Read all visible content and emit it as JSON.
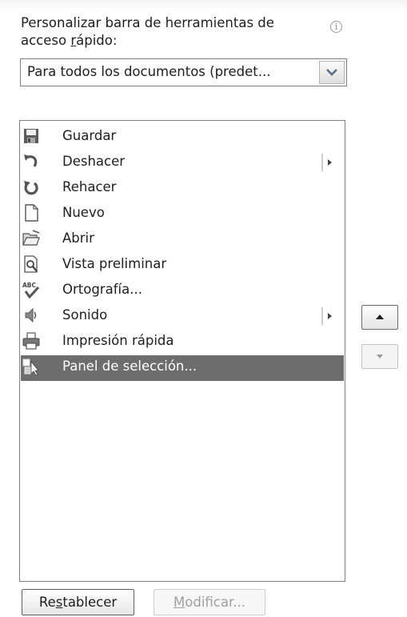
{
  "toolbar_panel": {
    "heading_line1": "Personalizar barra de herramientas de",
    "heading_line2_pre": "acceso ",
    "heading_line2_accel": "r",
    "heading_line2_post": "ápido:",
    "info_icon": "i",
    "scope_dropdown": {
      "value": "Para todos los documentos (predet...",
      "icon": "chevron-down-icon"
    },
    "commands": [
      {
        "label": "Guardar",
        "icon": "save-icon",
        "submenu": false,
        "selected": false
      },
      {
        "label": "Deshacer",
        "icon": "undo-icon",
        "submenu": true,
        "selected": false
      },
      {
        "label": "Rehacer",
        "icon": "redo-icon",
        "submenu": false,
        "selected": false
      },
      {
        "label": "Nuevo",
        "icon": "new-document-icon",
        "submenu": false,
        "selected": false
      },
      {
        "label": "Abrir",
        "icon": "open-folder-icon",
        "submenu": false,
        "selected": false
      },
      {
        "label": "Vista preliminar",
        "icon": "print-preview-icon",
        "submenu": false,
        "selected": false
      },
      {
        "label": "Ortografía...",
        "icon": "spelling-icon",
        "submenu": false,
        "selected": false
      },
      {
        "label": "Sonido",
        "icon": "sound-icon",
        "submenu": true,
        "selected": false
      },
      {
        "label": "Impresión rápida",
        "icon": "quick-print-icon",
        "submenu": false,
        "selected": false
      },
      {
        "label": "Panel de selección...",
        "icon": "selection-pane-icon",
        "submenu": false,
        "selected": true
      }
    ],
    "move_up_icon": "triangle-up-icon",
    "move_down_icon": "triangle-down-icon",
    "reset_button": {
      "pre": "Re",
      "accel": "s",
      "post": "tablecer"
    },
    "modify_button": {
      "pre": "",
      "accel": "M",
      "post": "odificar..."
    }
  }
}
